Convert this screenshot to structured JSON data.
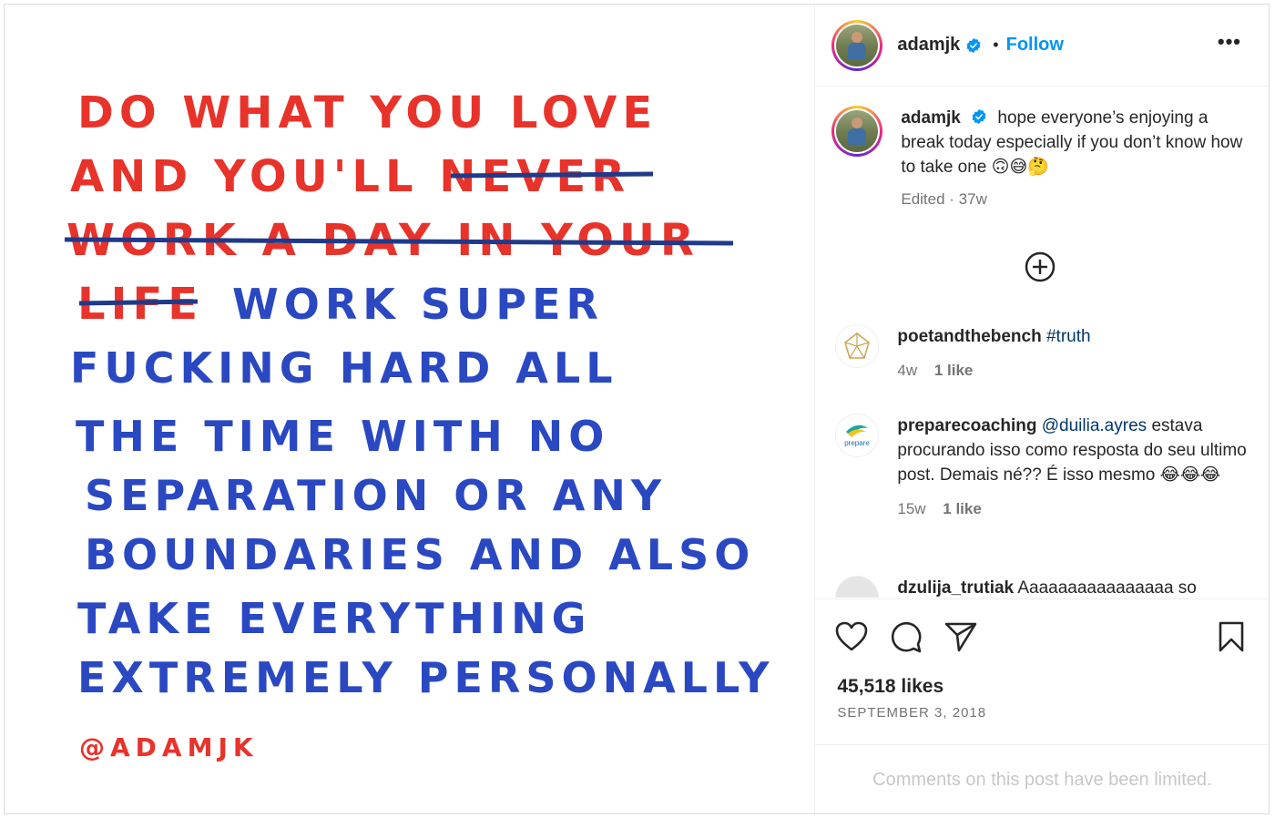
{
  "post": {
    "artwork_lines_red": [
      "DO WHAT YOU LOVE",
      "AND YOU'LL NEVER",
      "WORK A DAY IN YOUR",
      "LIFE"
    ],
    "artwork_lines_blue": [
      "WORK SUPER",
      "FUCKING HARD ALL",
      "THE TIME WITH NO",
      "SEPARATION OR ANY",
      "BOUNDARIES AND ALSO",
      "TAKE EVERYTHING",
      "EXTREMELY PERSONALLY"
    ],
    "artwork_signature": "@ADAMJK",
    "colors": {
      "red_crayon": "#e8332b",
      "blue_crayon": "#2a48c2",
      "strike": "#1f3a8a"
    }
  },
  "header": {
    "username": "adamjk",
    "separator": "•",
    "follow_label": "Follow",
    "more_icon": "more-horizontal-icon"
  },
  "caption": {
    "username": "adamjk",
    "text": "hope everyone’s enjoying a break today especially if you don’t know how to take one 🙃😅🤔",
    "meta": "Edited · 37w"
  },
  "comments": [
    {
      "username": "poetandthebench",
      "mention": "",
      "text": "#truth",
      "time": "4w",
      "likes": "1 like"
    },
    {
      "username": "preparecoaching",
      "mention": "@duilia.ayres",
      "text": "estava procurando isso como resposta do seu ultimo post. Demais né?? É isso mesmo 😂😂😂",
      "time": "15w",
      "likes": "1 like",
      "avatar_label": "prepare"
    },
    {
      "username": "dzulija_trutiak",
      "mention": "",
      "text": "Aaaaaaaaaaaaaaaa so"
    }
  ],
  "footer": {
    "likes": "45,518 likes",
    "date": "SEPTEMBER 3, 2018",
    "limited": "Comments on this post have been limited."
  },
  "colors": {
    "accent": "#0095f6",
    "verified": "#0095f6",
    "muted": "#737373",
    "mention": "#00376b"
  }
}
